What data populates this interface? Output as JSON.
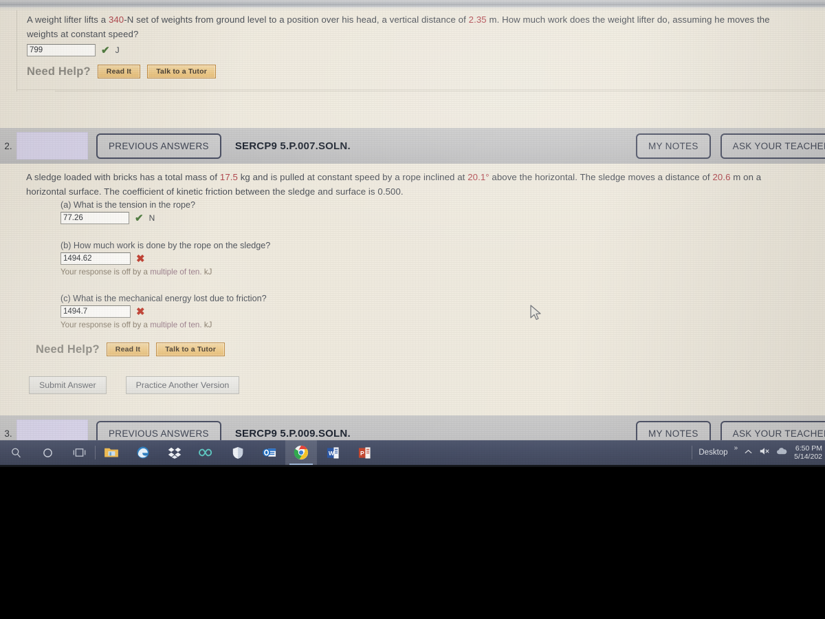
{
  "question1": {
    "text_before_1": "A weight lifter lifts a ",
    "num1": "340",
    "text_mid_1": "-N set of weights from ground level to a position over his head, a vertical distance of ",
    "num2": "2.35",
    "text_after": " m. How much work does the weight lifter do, assuming he moves the",
    "line2": "weights at constant speed?",
    "answer_value": "799",
    "answer_unit": "J",
    "status_icon": "check-icon",
    "need_help_label": "Need Help?",
    "read_it_label": "Read It",
    "talk_tutor_label": "Talk to a Tutor"
  },
  "question2": {
    "index": "2.",
    "previous_answers_label": "PREVIOUS ANSWERS",
    "code": "SERCP9 5.P.007.SOLN.",
    "my_notes_label": "MY NOTES",
    "ask_teacher_label": "ASK YOUR TEACHER",
    "stem_a": "A sledge loaded with bricks has a total mass of ",
    "stem_num1": "17.5",
    "stem_b": " kg and is pulled at constant speed by a rope inclined at ",
    "stem_num2": "20.1°",
    "stem_c": " above the horizontal. The sledge moves a distance of ",
    "stem_num3": "20.6",
    "stem_d": " m on a",
    "stem_line2": "horizontal surface. The coefficient of kinetic friction between the sledge and surface is 0.500.",
    "parts": [
      {
        "label": "(a) What is the tension in the rope?",
        "value": "77.26",
        "status": "correct",
        "unit": "N",
        "error": ""
      },
      {
        "label": "(b) How much work is done by the rope on the sledge?",
        "value": "1494.62",
        "status": "incorrect",
        "unit": "",
        "error_pre": "Your response is off by a ",
        "error_hl": "multiple of ten.",
        "error_post": " kJ"
      },
      {
        "label": "(c) What is the mechanical energy lost due to friction?",
        "value": "1494.7",
        "status": "incorrect",
        "unit": "",
        "error_pre": "Your response is off by a ",
        "error_hl": "multiple of ten.",
        "error_post": " kJ"
      }
    ],
    "need_help_label": "Need Help?",
    "read_it_label": "Read It",
    "talk_tutor_label": "Talk to a Tutor",
    "submit_label": "Submit Answer",
    "practice_label": "Practice Another Version"
  },
  "question3": {
    "index": "3.",
    "previous_answers_label": "PREVIOUS ANSWERS",
    "code": "SERCP9 5.P.009.SOLN.",
    "my_notes_label": "MY NOTES",
    "ask_teacher_label": "ASK YOUR TEACHER"
  },
  "taskbar": {
    "icons": [
      "search-icon",
      "cortana-icon",
      "task-view-icon",
      "file-explorer-icon",
      "edge-icon",
      "dropbox-icon",
      "infinity-icon",
      "defender-shield-icon",
      "outlook-icon",
      "chrome-icon",
      "word-icon",
      "powerpoint-icon"
    ],
    "desktop_label": "Desktop",
    "overflow_label": "»",
    "show_hidden_icon": "chevron-up-icon",
    "volume_icon": "speaker-muted-icon",
    "onedrive_icon": "cloud-icon",
    "time": "6:50 PM",
    "date": "5/14/202"
  },
  "colors": {
    "accent_red": "#b1474e",
    "correct_green": "#4f7c3f",
    "incorrect_red": "#c0392b",
    "purple_box": "#d9d5ec",
    "taskbar": "#434b63",
    "page_bg": "#efeade"
  }
}
